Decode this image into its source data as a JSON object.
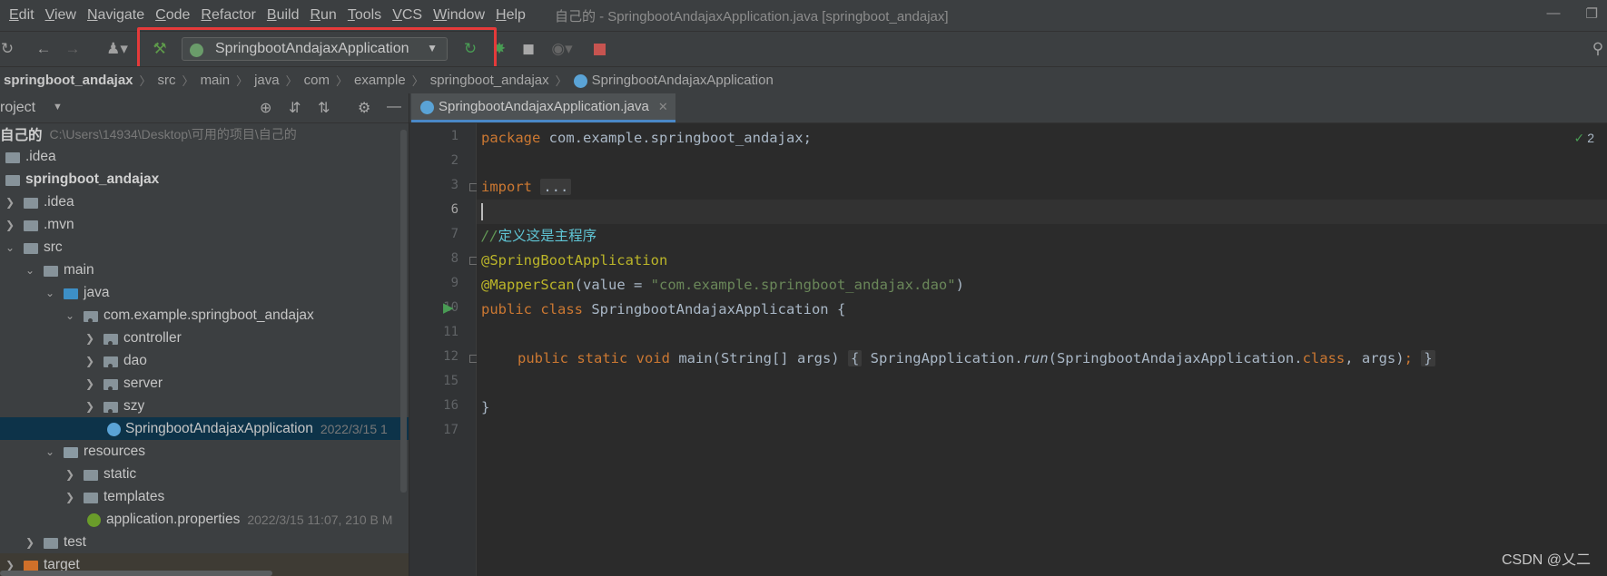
{
  "menu": [
    "Edit",
    "View",
    "Navigate",
    "Code",
    "Refactor",
    "Build",
    "Run",
    "Tools",
    "VCS",
    "Window",
    "Help"
  ],
  "window_title": "自己的 - SpringbootAndajaxApplication.java [springboot_andajax]",
  "toolbar": {
    "run_config": "SpringbootAndajaxApplication"
  },
  "breadcrumb": {
    "project": "springboot_andajax",
    "segments": [
      "src",
      "main",
      "java",
      "com",
      "example",
      "springboot_andajax"
    ],
    "current": "SpringbootAndajaxApplication"
  },
  "project_panel": {
    "title": "roject",
    "tree": [
      {
        "label": "自己的",
        "meta": "C:\\Users\\14934\\Desktop\\可用的项目\\自己的",
        "bold": true
      },
      {
        "label": ".idea"
      },
      {
        "label": "springboot_andajax",
        "bold": true
      },
      {
        "label": ".idea"
      },
      {
        "label": ".mvn"
      },
      {
        "label": "src"
      },
      {
        "label": "main"
      },
      {
        "label": "java"
      },
      {
        "label": "com.example.springboot_andajax"
      },
      {
        "label": "controller"
      },
      {
        "label": "dao"
      },
      {
        "label": "server"
      },
      {
        "label": "szy"
      },
      {
        "label": "SpringbootAndajaxApplication",
        "meta": "2022/3/15 1"
      },
      {
        "label": "resources"
      },
      {
        "label": "static"
      },
      {
        "label": "templates"
      },
      {
        "label": "application.properties",
        "meta": "2022/3/15 11:07, 210 B M"
      },
      {
        "label": "test"
      },
      {
        "label": "target"
      }
    ]
  },
  "editor": {
    "tab": "SpringbootAndajaxApplication.java",
    "line_numbers": [
      "1",
      "2",
      "3",
      "6",
      "7",
      "8",
      "9",
      "10",
      "11",
      "12",
      "15",
      "16",
      "17"
    ],
    "code": {
      "l1_kw": "package",
      "l1_rest": " com.example.springboot_andajax;",
      "l3_kw": "import",
      "l3_fold": "...",
      "l7_comment": "//",
      "l7_comment_zh": "定义这是主程序",
      "l8_ann": "@SpringBootApplication",
      "l9_ann": "@MapperScan",
      "l9_a": "(value = ",
      "l9_str": "\"com.example.springboot_andajax.dao\"",
      "l9_b": ")",
      "l10_kw": "public class",
      "l10_rest": " SpringbootAndajaxApplication {",
      "l12_kw": "public static void",
      "l12_a": " main(String[] args) ",
      "l12_open": "{",
      "l12_b": " SpringApplication.",
      "l12_run": "run",
      "l12_c": "(SpringbootAndajaxApplication.",
      "l12_class": "class",
      "l12_d": ", args)",
      "l12_semi": ";",
      "l12_close": "}",
      "l16": "}"
    },
    "inspection_count": "2"
  },
  "watermark": "CSDN @乂二",
  "colors": {
    "highlight": "#e53a3a",
    "selection": "#0d3349",
    "keyword": "#cc7832",
    "annotation": "#bbb529",
    "string": "#6a8759"
  }
}
